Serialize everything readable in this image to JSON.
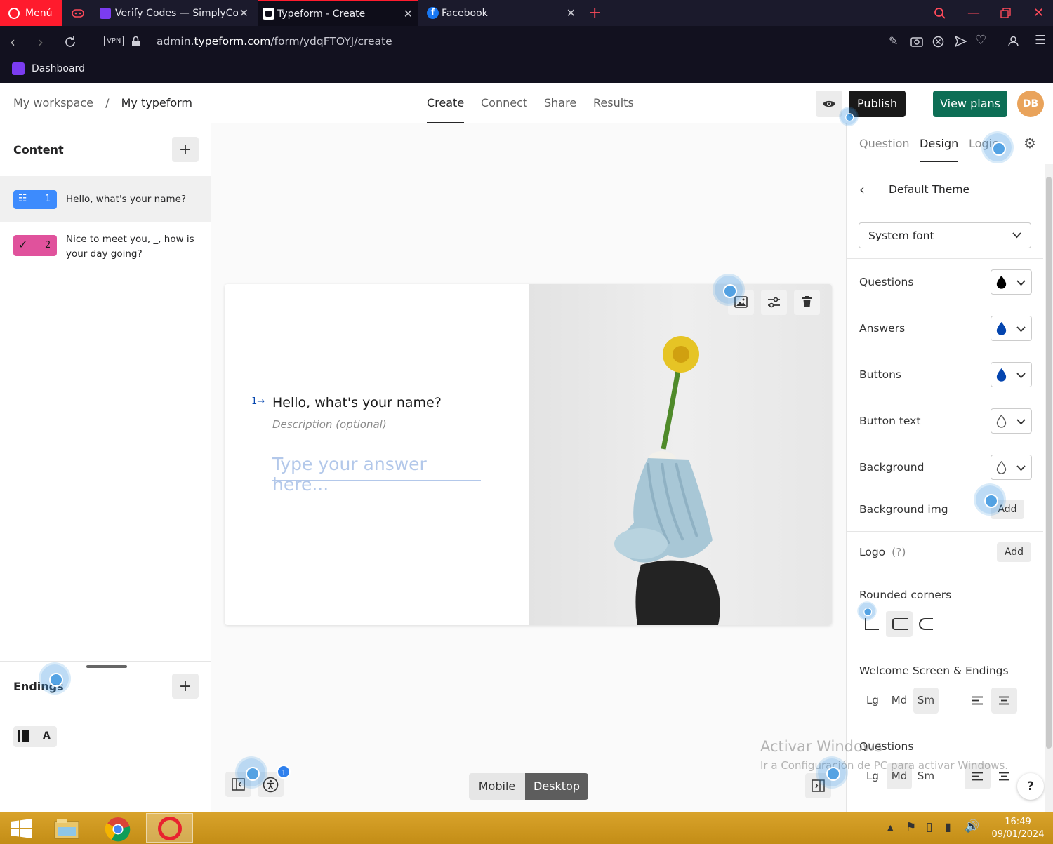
{
  "browser": {
    "menu_label": "Menú",
    "tabs": [
      {
        "label": "Verify Codes — SimplyCodes"
      },
      {
        "label": "Typeform - Create"
      },
      {
        "label": "Facebook"
      }
    ],
    "vpn": "VPN",
    "url_prefix": "admin.",
    "url_domain": "typeform.com",
    "url_path": "/form/ydqFTOYJ/create",
    "bookmark": "Dashboard"
  },
  "header": {
    "breadcrumb_workspace": "My workspace",
    "breadcrumb_sep": "/",
    "breadcrumb_form": "My typeform",
    "tabs": [
      "Create",
      "Connect",
      "Share",
      "Results"
    ],
    "active_tab": "Create",
    "publish": "Publish",
    "view_plans": "View plans",
    "avatar": "DB"
  },
  "content": {
    "title": "Content",
    "add": "+",
    "questions": [
      {
        "number": "1",
        "text": "Hello, what's your name?",
        "color": "#3d8bfd"
      },
      {
        "number": "2",
        "text": "Nice to meet you, _, how is your day going?",
        "color": "#e0529c"
      }
    ],
    "endings_title": "Endings",
    "endings_add": "+",
    "ending_letter": "A"
  },
  "preview": {
    "qnum": "1",
    "question": "Hello, what's your name?",
    "description": "Description (optional)",
    "answer_placeholder": "Type your answer here...",
    "device_mobile": "Mobile",
    "device_desktop": "Desktop",
    "active_device": "Desktop",
    "a11y_badge": "1"
  },
  "design": {
    "tabs": [
      "Question",
      "Design",
      "Logic"
    ],
    "active_tab": "Design",
    "theme_name": "Default Theme",
    "font": "System font",
    "colors": [
      {
        "label": "Questions",
        "color": "#000000"
      },
      {
        "label": "Answers",
        "color": "#0445af"
      },
      {
        "label": "Buttons",
        "color": "#0445af"
      },
      {
        "label": "Button text",
        "color": "#ffffff"
      },
      {
        "label": "Background",
        "color": "#ffffff"
      }
    ],
    "background_img_label": "Background img",
    "background_img_add": "Add",
    "logo_label": "Logo",
    "logo_hint": "(?)",
    "logo_add": "Add",
    "rounded_label": "Rounded corners",
    "welcome_label": "Welcome Screen & Endings",
    "questions_label": "Questions",
    "sizes": [
      "Lg",
      "Md",
      "Sm"
    ],
    "welcome_size": "Sm",
    "questions_size": "Md",
    "help": "?"
  },
  "watermark": {
    "line1": "Activar Windows",
    "line2": "Ir a Configuración de PC para activar Windows."
  },
  "taskbar": {
    "time": "16:49",
    "date": "09/01/2024"
  }
}
